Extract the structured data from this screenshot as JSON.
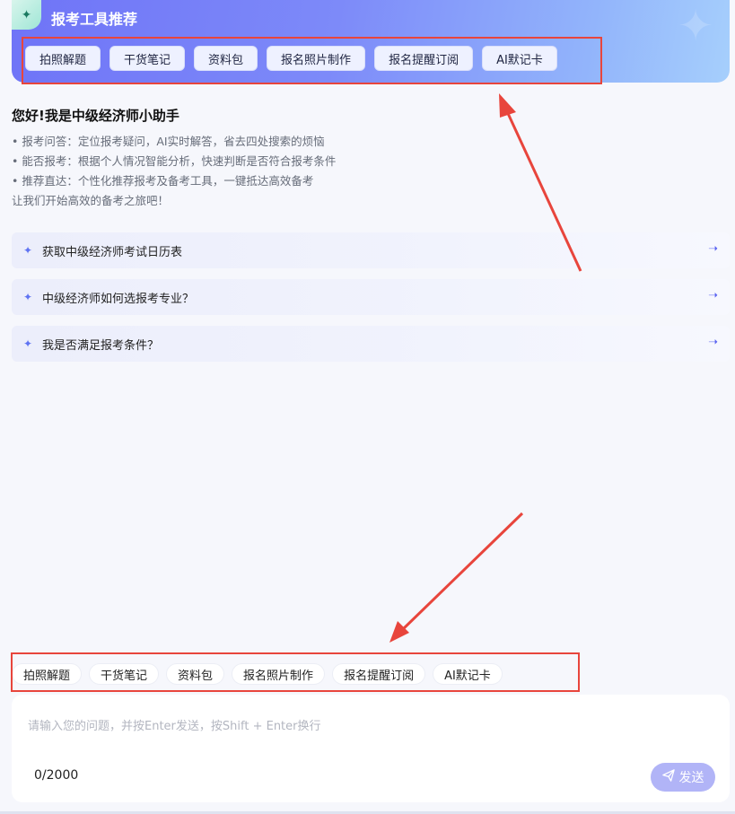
{
  "banner": {
    "title": "报考工具推荐",
    "logo_icon": "sparkle-icon",
    "tools": [
      "拍照解题",
      "干货笔记",
      "资料包",
      "报名照片制作",
      "报名提醒订阅",
      "AI默记卡"
    ]
  },
  "greeting": {
    "title": "您好!我是中级经济师小助手",
    "lines": [
      "• 报考问答：定位报考疑问，AI实时解答，省去四处搜索的烦恼",
      "• 能否报考：根据个人情况智能分析，快速判断是否符合报考条件",
      "• 推荐直达：个性化推荐报考及备考工具，一键抵达高效备考",
      "让我们开始高效的备考之旅吧！"
    ]
  },
  "suggestions": [
    "获取中级经济师考试日历表",
    "中级经济师如何选报考专业？",
    "我是否满足报考条件？"
  ],
  "chips": [
    "拍照解题",
    "干货笔记",
    "资料包",
    "报名照片制作",
    "报名提醒订阅",
    "AI默记卡"
  ],
  "input": {
    "placeholder": "请输入您的问题，并按Enter发送，按Shift + Enter换行",
    "value": "",
    "counter": "0/2000",
    "send_label": "发送"
  },
  "colors": {
    "accent": "#6f74f7",
    "annotation": "#e8453c"
  }
}
